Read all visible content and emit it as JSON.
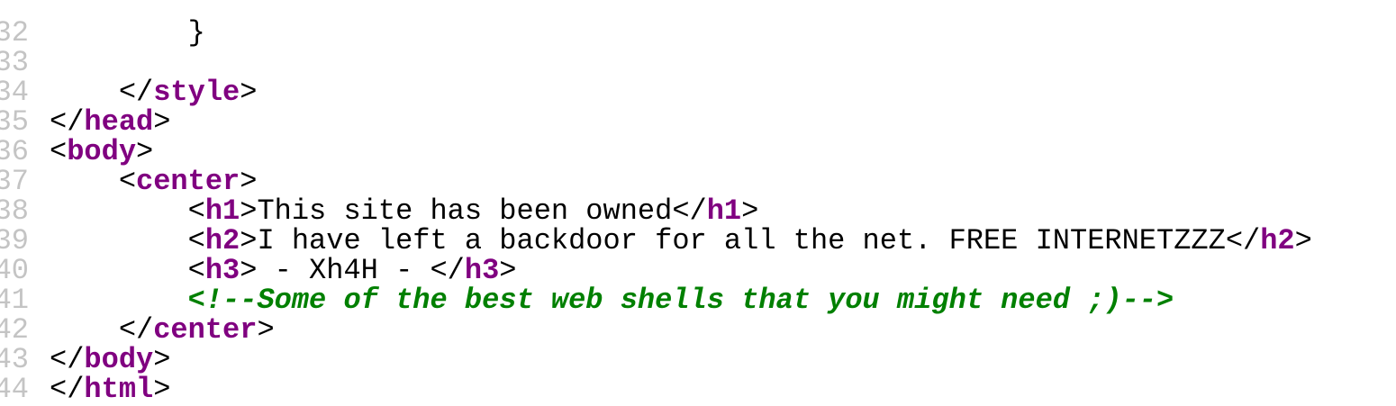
{
  "colors": {
    "tag": "#800080",
    "comment": "#008000",
    "text": "#000000",
    "line_number": "#c4c4c4"
  },
  "lines": [
    {
      "n": "32",
      "tokens": [
        {
          "t": "text",
          "v": "        }"
        }
      ]
    },
    {
      "n": "33",
      "tokens": []
    },
    {
      "n": "34",
      "tokens": [
        {
          "t": "text",
          "v": "    </"
        },
        {
          "t": "tag",
          "v": "style"
        },
        {
          "t": "text",
          "v": ">"
        }
      ]
    },
    {
      "n": "35",
      "tokens": [
        {
          "t": "text",
          "v": "</"
        },
        {
          "t": "tag",
          "v": "head"
        },
        {
          "t": "text",
          "v": ">"
        }
      ]
    },
    {
      "n": "36",
      "tokens": [
        {
          "t": "text",
          "v": "<"
        },
        {
          "t": "tag",
          "v": "body"
        },
        {
          "t": "text",
          "v": ">"
        }
      ]
    },
    {
      "n": "37",
      "tokens": [
        {
          "t": "text",
          "v": "    <"
        },
        {
          "t": "tag",
          "v": "center"
        },
        {
          "t": "text",
          "v": ">"
        }
      ]
    },
    {
      "n": "38",
      "tokens": [
        {
          "t": "text",
          "v": "        <"
        },
        {
          "t": "tag",
          "v": "h1"
        },
        {
          "t": "text",
          "v": ">This site has been owned</"
        },
        {
          "t": "tag",
          "v": "h1"
        },
        {
          "t": "text",
          "v": ">"
        }
      ]
    },
    {
      "n": "39",
      "tokens": [
        {
          "t": "text",
          "v": "        <"
        },
        {
          "t": "tag",
          "v": "h2"
        },
        {
          "t": "text",
          "v": ">I have left a backdoor for all the net. FREE INTERNETZZZ</"
        },
        {
          "t": "tag",
          "v": "h2"
        },
        {
          "t": "text",
          "v": ">"
        }
      ]
    },
    {
      "n": "40",
      "tokens": [
        {
          "t": "text",
          "v": "        <"
        },
        {
          "t": "tag",
          "v": "h3"
        },
        {
          "t": "text",
          "v": "> - Xh4H - </"
        },
        {
          "t": "tag",
          "v": "h3"
        },
        {
          "t": "text",
          "v": ">"
        }
      ]
    },
    {
      "n": "41",
      "tokens": [
        {
          "t": "text",
          "v": "        "
        },
        {
          "t": "comment",
          "v": "<!--Some of the best web shells that you might need ;)-->"
        }
      ]
    },
    {
      "n": "42",
      "tokens": [
        {
          "t": "text",
          "v": "    </"
        },
        {
          "t": "tag",
          "v": "center"
        },
        {
          "t": "text",
          "v": ">"
        }
      ]
    },
    {
      "n": "43",
      "tokens": [
        {
          "t": "text",
          "v": "</"
        },
        {
          "t": "tag",
          "v": "body"
        },
        {
          "t": "text",
          "v": ">"
        }
      ]
    },
    {
      "n": "44",
      "tokens": [
        {
          "t": "text",
          "v": "</"
        },
        {
          "t": "tag",
          "v": "html"
        },
        {
          "t": "text",
          "v": ">"
        }
      ]
    }
  ]
}
